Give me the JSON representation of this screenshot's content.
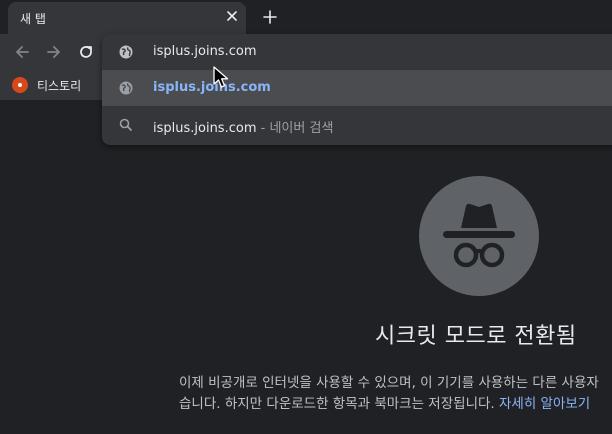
{
  "tab": {
    "title": "새 탭",
    "close_icon": "close-icon"
  },
  "new_tab_icon": "plus-icon",
  "toolbar": {
    "back_icon": "arrow-left-icon",
    "forward_icon": "arrow-right-icon",
    "reload_icon": "reload-icon"
  },
  "bookmarks": [
    {
      "label": "티스토리",
      "icon": "tistory-icon",
      "color": "#d9481a"
    }
  ],
  "omnibox": {
    "input_value": "isplus.joins.com",
    "suggestions": [
      {
        "text": "isplus.joins.com",
        "icon": "globe-icon",
        "selected": true
      },
      {
        "text": "isplus.joins.com",
        "separator": "-",
        "description": "네이버 검색",
        "icon": "search-icon"
      }
    ]
  },
  "incognito": {
    "icon": "incognito-icon",
    "heading": "시크릿 모드로 전환됨",
    "body_line1": "이제 비공개로 인터넷을 사용할 수 있으며, 이 기기를 사용하는 다른 사용자",
    "body_line2": "습니다. 하지만 다운로드한 항목과 북마크는 저장됩니다. ",
    "link": "자세히 알아보기"
  },
  "colors": {
    "background": "#202124",
    "toolbar": "#35363a",
    "link": "#8ab4f8",
    "selected_row": "#4a4c50"
  }
}
